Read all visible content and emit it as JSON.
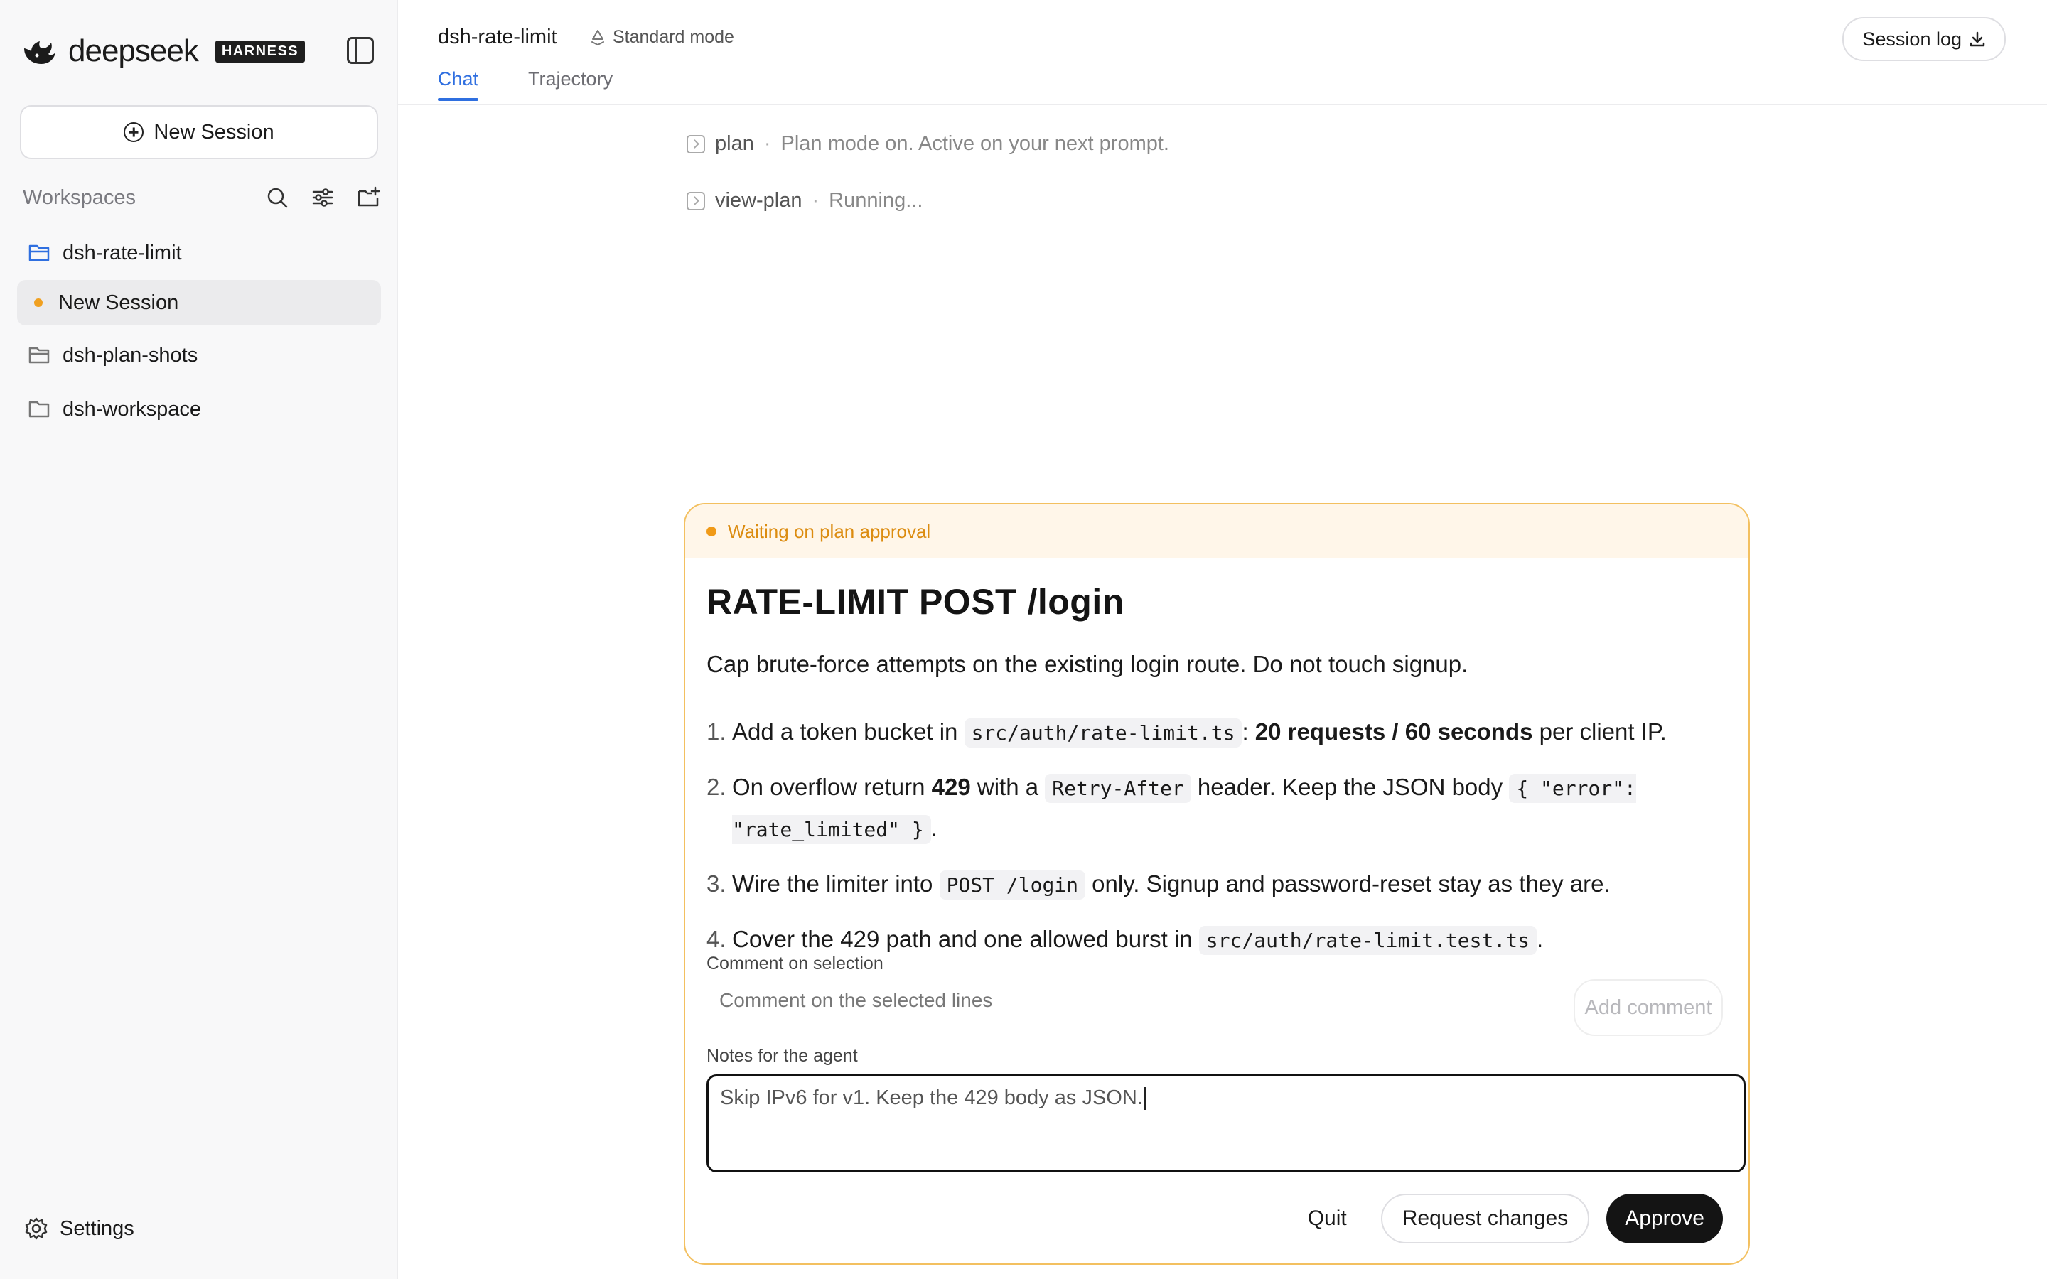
{
  "brand": {
    "wordmark": "deepseek",
    "tag": "HARNESS"
  },
  "sidebar": {
    "new_session_label": "New Session",
    "workspaces_label": "Workspaces",
    "items": [
      {
        "label": "dsh-rate-limit",
        "icon": "folder-open-icon",
        "color": "#2f6fe0"
      },
      {
        "label": "New Session",
        "active": true,
        "status_color": "#f0a020"
      },
      {
        "label": "dsh-plan-shots",
        "icon": "folder-icon"
      },
      {
        "label": "dsh-workspace",
        "icon": "folder-icon"
      }
    ],
    "settings_label": "Settings"
  },
  "header": {
    "title": "dsh-rate-limit",
    "mode": "Standard mode",
    "tabs": [
      {
        "label": "Chat",
        "active": true
      },
      {
        "label": "Trajectory"
      }
    ],
    "session_log_label": "Session log"
  },
  "activity": [
    {
      "name": "plan",
      "separator": "·",
      "desc": "Plan mode on. Active on your next prompt."
    },
    {
      "name": "view-plan",
      "separator": "·",
      "desc": "Running..."
    }
  ],
  "plan": {
    "status": "Waiting on plan approval",
    "title": "RATE-LIMIT POST /login",
    "intro": "Cap brute-force attempts on the existing login route. Do not touch signup.",
    "steps": [
      {
        "num": "1.",
        "parts": [
          {
            "t": "text",
            "v": "Add a token bucket in "
          },
          {
            "t": "code",
            "v": "src/auth/rate-limit.ts"
          },
          {
            "t": "text",
            "v": ": "
          },
          {
            "t": "bold",
            "v": "20 requests / 60 seconds"
          },
          {
            "t": "text",
            "v": " per client IP."
          }
        ]
      },
      {
        "num": "2.",
        "parts": [
          {
            "t": "text",
            "v": "On overflow return "
          },
          {
            "t": "bold",
            "v": "429"
          },
          {
            "t": "text",
            "v": " with a "
          },
          {
            "t": "code",
            "v": "Retry-After"
          },
          {
            "t": "text",
            "v": " header. Keep the JSON body "
          },
          {
            "t": "code",
            "v": "{ \"error\": \"rate_limited\" }"
          },
          {
            "t": "text",
            "v": "."
          }
        ]
      },
      {
        "num": "3.",
        "parts": [
          {
            "t": "text",
            "v": "Wire the limiter into "
          },
          {
            "t": "code",
            "v": "POST /login"
          },
          {
            "t": "text",
            "v": " only. Signup and password-reset stay as they are."
          }
        ]
      },
      {
        "num": "4.",
        "parts": [
          {
            "t": "text",
            "v": "Cover the 429 path and one allowed burst in "
          },
          {
            "t": "code",
            "v": "src/auth/rate-limit.test.ts"
          },
          {
            "t": "text",
            "v": "."
          }
        ]
      }
    ],
    "comment_label": "Comment on selection",
    "comment_placeholder": "Comment on the selected lines",
    "add_comment_label": "Add comment",
    "notes_label": "Notes for the agent",
    "notes_value": "Skip IPv6 for v1. Keep the 429 body as JSON.",
    "quit_label": "Quit",
    "request_changes_label": "Request changes",
    "approve_label": "Approve"
  },
  "colors": {
    "accent": "#2f6fe0",
    "warning": "#f0a020",
    "primary_button": "#141414"
  }
}
